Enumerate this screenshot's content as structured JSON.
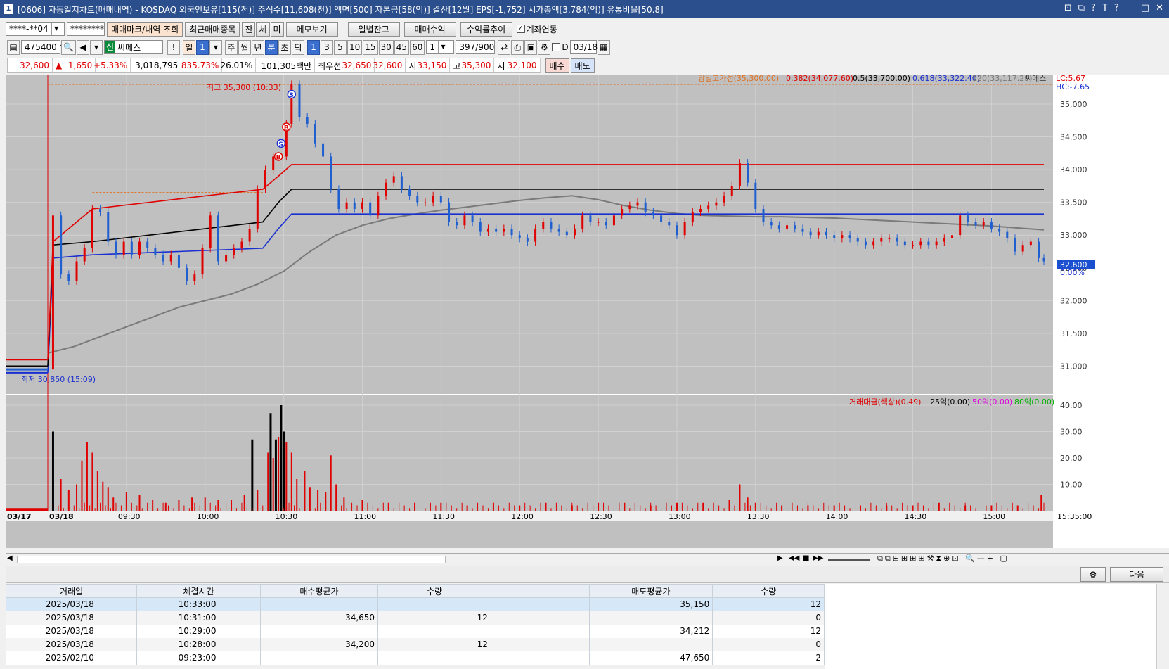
{
  "titlebar": {
    "window_number": "1",
    "title": "[0606] 자동일지차트(매매내역) - KOSDAQ 외국인보유[115(천)] 주식수[11,608(천)] 액면[500] 자본금[58(억)] 결산[12월] EPS[-1,752] 시가총액[3,784(억)] 유통비율[50.8]",
    "controls": [
      "⊡",
      "⧉",
      "?",
      "T",
      "?",
      "—",
      "□",
      "✕"
    ]
  },
  "toolbar1": {
    "account": "****-**04",
    "password": "********",
    "btn_mark": "매매마크/내역 조회",
    "btn_recent": "최근매매종목",
    "btn_jan": "잔",
    "btn_che": "체",
    "btn_mi": "미",
    "btn_memo": "메모보기",
    "btn_daily": "일별잔고",
    "btn_profit": "매매수익",
    "btn_trend": "수익률추이",
    "chk_link": "계좌연동"
  },
  "toolbar2": {
    "code": "475400",
    "shin": "신",
    "name": "씨메스",
    "excl": "!",
    "period_il": "일",
    "period_num": "1",
    "ju": "주",
    "wol": "월",
    "nyeon": "년",
    "bun": "분",
    "cho": "초",
    "tik": "틱",
    "intervals": [
      "1",
      "3",
      "5",
      "10",
      "15",
      "30",
      "45",
      "60"
    ],
    "interval_sel": "1",
    "count": "397",
    "count_max": "/900",
    "d_label": "D",
    "date": "03/18"
  },
  "quote": {
    "price": "32,600",
    "arrow": "▲",
    "change": "1,650",
    "rate": "+5.33%",
    "volume": "3,018,795",
    "vol_ratio": "835.73%",
    "turnover": "26.01%",
    "amount": "101,305백만",
    "best_ask_label": "최우선",
    "best_ask": "32,650",
    "best_bid": "32,600",
    "open_label": "시",
    "open": "33,150",
    "high_label": "고",
    "high": "35,300",
    "low_label": "저",
    "low": "32,100",
    "buy": "매수",
    "sell": "매도"
  },
  "colors": {
    "bg": "#c0c0c0",
    "up": "#e00000",
    "down": "#1f5fd0",
    "ma": "#7a7a7a",
    "high_line": "#e00000",
    "mid_line": "#000000",
    "low_line": "#1a2fd0",
    "fib_orange": "#e07020"
  },
  "chart_data": {
    "type": "line",
    "legend_top": {
      "high_label": "당일고가선(35,300.00)",
      "f382": "0.382(34,077.60)",
      "f5": "0.5(33,700.00)",
      "f618": "0.618(33,322.40)",
      "ma120": "120(33,117.29)",
      "stock": "씨메스"
    },
    "corner_lc": "LC:5.67",
    "corner_hc": "HC:-7.65",
    "high_marker": "최고 35,300 (10:33)",
    "low_marker": "최저 30,850 (15:09)",
    "current_price_tag": "32,600",
    "current_pct": "0.00%",
    "y_ticks": [
      "35,000",
      "34,500",
      "34,000",
      "33,500",
      "33,000",
      "32,500",
      "32,000",
      "31,500",
      "31,000"
    ],
    "y_values": [
      35000,
      34500,
      34000,
      33500,
      33000,
      32500,
      32000,
      31500,
      31000
    ],
    "ylim": [
      30780,
      35300
    ],
    "x_labels": [
      "03/17",
      "03/18",
      "09:30",
      "10:00",
      "10:30",
      "11:00",
      "11:30",
      "12:00",
      "12:30",
      "13:00",
      "13:30",
      "14:00",
      "14:30",
      "15:00",
      "15:35:00"
    ],
    "x_times": [
      "09:00",
      "09:00",
      "09:30",
      "10:00",
      "10:30",
      "11:00",
      "11:30",
      "12:00",
      "12:30",
      "13:00",
      "13:30",
      "14:00",
      "14:30",
      "15:00",
      "15:35"
    ],
    "price_series": [
      [
        "09:00",
        30950
      ],
      [
        "09:02",
        33300
      ],
      [
        "09:05",
        32400
      ],
      [
        "09:08",
        32300
      ],
      [
        "09:11",
        32600
      ],
      [
        "09:14",
        32800
      ],
      [
        "09:17",
        33400
      ],
      [
        "09:20",
        33350
      ],
      [
        "09:23",
        32900
      ],
      [
        "09:26",
        32700
      ],
      [
        "09:29",
        32900
      ],
      [
        "09:32",
        32700
      ],
      [
        "09:35",
        32900
      ],
      [
        "09:38",
        32800
      ],
      [
        "09:41",
        32700
      ],
      [
        "09:44",
        32600
      ],
      [
        "09:47",
        32700
      ],
      [
        "09:50",
        32500
      ],
      [
        "09:53",
        32300
      ],
      [
        "09:56",
        32400
      ],
      [
        "09:59",
        32800
      ],
      [
        "10:02",
        33300
      ],
      [
        "10:05",
        32600
      ],
      [
        "10:08",
        32700
      ],
      [
        "10:11",
        32800
      ],
      [
        "10:14",
        32900
      ],
      [
        "10:17",
        33100
      ],
      [
        "10:20",
        33700
      ],
      [
        "10:23",
        34000
      ],
      [
        "10:26",
        34200
      ],
      [
        "10:28",
        34200
      ],
      [
        "10:31",
        34700
      ],
      [
        "10:33",
        35300
      ],
      [
        "10:36",
        34800
      ],
      [
        "10:39",
        34700
      ],
      [
        "10:42",
        34400
      ],
      [
        "10:45",
        34200
      ],
      [
        "10:48",
        33700
      ],
      [
        "10:51",
        33400
      ],
      [
        "10:54",
        33500
      ],
      [
        "10:57",
        33400
      ],
      [
        "11:00",
        33500
      ],
      [
        "11:03",
        33300
      ],
      [
        "11:06",
        33600
      ],
      [
        "11:09",
        33800
      ],
      [
        "11:12",
        33900
      ],
      [
        "11:15",
        33700
      ],
      [
        "11:18",
        33600
      ],
      [
        "11:21",
        33500
      ],
      [
        "11:24",
        33500
      ],
      [
        "11:27",
        33600
      ],
      [
        "11:30",
        33500
      ],
      [
        "11:33",
        33200
      ],
      [
        "11:36",
        33150
      ],
      [
        "11:39",
        33300
      ],
      [
        "11:42",
        33200
      ],
      [
        "11:45",
        33050
      ],
      [
        "11:48",
        33100
      ],
      [
        "11:51",
        33050
      ],
      [
        "11:54",
        33100
      ],
      [
        "11:57",
        33000
      ],
      [
        "12:00",
        32950
      ],
      [
        "12:03",
        32900
      ],
      [
        "12:06",
        33100
      ],
      [
        "12:09",
        33200
      ],
      [
        "12:12",
        33100
      ],
      [
        "12:15",
        33050
      ],
      [
        "12:18",
        33000
      ],
      [
        "12:21",
        33100
      ],
      [
        "12:24",
        33300
      ],
      [
        "12:27",
        33200
      ],
      [
        "12:30",
        33200
      ],
      [
        "12:33",
        33150
      ],
      [
        "12:36",
        33300
      ],
      [
        "12:39",
        33400
      ],
      [
        "12:42",
        33450
      ],
      [
        "12:45",
        33500
      ],
      [
        "12:48",
        33350
      ],
      [
        "12:51",
        33300
      ],
      [
        "12:54",
        33200
      ],
      [
        "12:57",
        33150
      ],
      [
        "13:00",
        33000
      ],
      [
        "13:03",
        33200
      ],
      [
        "13:06",
        33350
      ],
      [
        "13:09",
        33400
      ],
      [
        "13:12",
        33450
      ],
      [
        "13:15",
        33500
      ],
      [
        "13:18",
        33600
      ],
      [
        "13:21",
        33750
      ],
      [
        "13:24",
        34100
      ],
      [
        "13:27",
        33800
      ],
      [
        "13:30",
        33400
      ],
      [
        "13:33",
        33200
      ],
      [
        "13:36",
        33150
      ],
      [
        "13:39",
        33100
      ],
      [
        "13:42",
        33150
      ],
      [
        "13:45",
        33100
      ],
      [
        "13:48",
        33050
      ],
      [
        "13:51",
        33000
      ],
      [
        "13:54",
        33050
      ],
      [
        "13:57",
        33000
      ],
      [
        "14:00",
        32950
      ],
      [
        "14:03",
        33000
      ],
      [
        "14:06",
        32950
      ],
      [
        "14:09",
        32900
      ],
      [
        "14:12",
        32850
      ],
      [
        "14:15",
        32900
      ],
      [
        "14:18",
        32950
      ],
      [
        "14:21",
        32950
      ],
      [
        "14:24",
        32900
      ],
      [
        "14:27",
        32850
      ],
      [
        "14:30",
        32850
      ],
      [
        "14:33",
        32900
      ],
      [
        "14:36",
        32850
      ],
      [
        "14:39",
        32900
      ],
      [
        "14:42",
        32950
      ],
      [
        "14:45",
        33000
      ],
      [
        "14:48",
        33300
      ],
      [
        "14:51",
        33200
      ],
      [
        "14:54",
        33150
      ],
      [
        "14:57",
        33200
      ],
      [
        "15:00",
        33100
      ],
      [
        "15:03",
        33050
      ],
      [
        "15:06",
        32950
      ],
      [
        "15:09",
        32750
      ],
      [
        "15:12",
        32850
      ],
      [
        "15:15",
        32900
      ],
      [
        "15:18",
        32650
      ],
      [
        "15:20",
        32600
      ]
    ],
    "ma_series": [
      [
        "09:00",
        31200
      ],
      [
        "09:10",
        31300
      ],
      [
        "09:20",
        31450
      ],
      [
        "09:30",
        31600
      ],
      [
        "09:40",
        31750
      ],
      [
        "09:50",
        31900
      ],
      [
        "10:00",
        32000
      ],
      [
        "10:10",
        32100
      ],
      [
        "10:20",
        32250
      ],
      [
        "10:30",
        32450
      ],
      [
        "10:40",
        32750
      ],
      [
        "10:50",
        33000
      ],
      [
        "11:00",
        33150
      ],
      [
        "11:10",
        33250
      ],
      [
        "11:20",
        33320
      ],
      [
        "11:30",
        33380
      ],
      [
        "11:40",
        33430
      ],
      [
        "11:50",
        33480
      ],
      [
        "12:00",
        33530
      ],
      [
        "12:10",
        33570
      ],
      [
        "12:20",
        33600
      ],
      [
        "12:30",
        33540
      ],
      [
        "12:40",
        33450
      ],
      [
        "12:50",
        33380
      ],
      [
        "13:00",
        33330
      ],
      [
        "13:10",
        33300
      ],
      [
        "13:20",
        33290
      ],
      [
        "13:30",
        33280
      ],
      [
        "13:40",
        33280
      ],
      [
        "13:50",
        33270
      ],
      [
        "14:00",
        33260
      ],
      [
        "14:10",
        33240
      ],
      [
        "14:20",
        33220
      ],
      [
        "14:30",
        33200
      ],
      [
        "14:40",
        33180
      ],
      [
        "14:50",
        33160
      ],
      [
        "15:00",
        33140
      ],
      [
        "15:10",
        33110
      ],
      [
        "15:20",
        33080
      ]
    ],
    "day_high_series": [
      [
        "09:00",
        31100
      ],
      [
        "09:02",
        32900
      ],
      [
        "09:17",
        33400
      ],
      [
        "10:22",
        33700
      ],
      [
        "10:28",
        33900
      ],
      [
        "10:33",
        34077
      ]
    ],
    "day_mid_series": [
      [
        "09:00",
        31000
      ],
      [
        "09:02",
        32850
      ],
      [
        "09:17",
        32900
      ],
      [
        "10:22",
        33200
      ],
      [
        "10:28",
        33500
      ],
      [
        "10:33",
        33700
      ]
    ],
    "day_low_series": [
      [
        "09:00",
        30900
      ],
      [
        "09:02",
        32650
      ],
      [
        "09:17",
        32700
      ],
      [
        "10:22",
        32800
      ],
      [
        "10:28",
        33100
      ],
      [
        "10:33",
        33322
      ]
    ],
    "trade_marks": [
      {
        "time": "10:28",
        "price": 34200,
        "label": "B"
      },
      {
        "time": "10:29",
        "price": 34400,
        "label": "S"
      },
      {
        "time": "10:31",
        "price": 34650,
        "label": "B"
      },
      {
        "time": "10:33",
        "price": 35150,
        "label": "S"
      }
    ],
    "volume_panel": {
      "legend_main": "거래대금(색상)(0.49)",
      "legend_25": "25억(0.00)",
      "legend_50": "50억(0.00)",
      "legend_80": "80억(0.00)",
      "y_ticks": [
        "40.00",
        "30.00",
        "20.00",
        "10.00"
      ],
      "y_values": [
        40,
        30,
        20,
        10
      ],
      "ylim": [
        0,
        40
      ],
      "black_bars": [
        [
          "09:02",
          30
        ],
        [
          "10:18",
          27
        ],
        [
          "10:25",
          37
        ],
        [
          "10:27",
          27
        ],
        [
          "10:29",
          40
        ],
        [
          "10:30",
          30
        ]
      ],
      "red_bars": [
        [
          "09:05",
          12
        ],
        [
          "09:08",
          8
        ],
        [
          "09:11",
          10
        ],
        [
          "09:13",
          19
        ],
        [
          "09:15",
          26
        ],
        [
          "09:17",
          22
        ],
        [
          "09:19",
          15
        ],
        [
          "09:21",
          11
        ],
        [
          "09:23",
          9
        ],
        [
          "09:25",
          5
        ],
        [
          "09:30",
          7
        ],
        [
          "09:35",
          6
        ],
        [
          "09:40",
          4
        ],
        [
          "09:45",
          3
        ],
        [
          "09:50",
          4
        ],
        [
          "09:55",
          5
        ],
        [
          "10:00",
          5
        ],
        [
          "10:05",
          4
        ],
        [
          "10:10",
          4
        ],
        [
          "10:15",
          6
        ],
        [
          "10:20",
          8
        ],
        [
          "10:24",
          22
        ],
        [
          "10:26",
          20
        ],
        [
          "10:28",
          28
        ],
        [
          "10:31",
          26
        ],
        [
          "10:33",
          22
        ],
        [
          "10:35",
          12
        ],
        [
          "10:38",
          15
        ],
        [
          "10:40",
          9
        ],
        [
          "10:43",
          8
        ],
        [
          "10:46",
          7
        ],
        [
          "10:48",
          21
        ],
        [
          "10:50",
          10
        ],
        [
          "10:53",
          5
        ],
        [
          "11:00",
          4
        ],
        [
          "11:10",
          3
        ],
        [
          "11:20",
          3
        ],
        [
          "11:30",
          3
        ],
        [
          "11:40",
          2
        ],
        [
          "11:50",
          3
        ],
        [
          "12:00",
          2
        ],
        [
          "12:10",
          3
        ],
        [
          "12:20",
          2
        ],
        [
          "12:30",
          3
        ],
        [
          "12:40",
          3
        ],
        [
          "12:50",
          2
        ],
        [
          "13:00",
          3
        ],
        [
          "13:10",
          3
        ],
        [
          "13:20",
          4
        ],
        [
          "13:24",
          10
        ],
        [
          "13:27",
          5
        ],
        [
          "13:30",
          3
        ],
        [
          "13:40",
          2
        ],
        [
          "13:50",
          2
        ],
        [
          "14:00",
          2
        ],
        [
          "14:10",
          2
        ],
        [
          "14:20",
          2
        ],
        [
          "14:30",
          2
        ],
        [
          "14:40",
          3
        ],
        [
          "14:50",
          2
        ],
        [
          "15:00",
          2
        ],
        [
          "15:10",
          2
        ],
        [
          "15:19",
          6
        ]
      ]
    }
  },
  "scrollbar": {
    "page_next": "다음",
    "settings": "⚙"
  },
  "table": {
    "headers": [
      "거래일",
      "체결시간",
      "매수평균가",
      "수량",
      "",
      "매도평균가",
      "수량"
    ],
    "rows": [
      [
        "2025/03/18",
        "10:33:00",
        "",
        "",
        "",
        "35,150",
        "12"
      ],
      [
        "2025/03/18",
        "10:31:00",
        "34,650",
        "12",
        "",
        "",
        "0"
      ],
      [
        "2025/03/18",
        "10:29:00",
        "",
        "",
        "",
        "34,212",
        "12"
      ],
      [
        "2025/03/18",
        "10:28:00",
        "34,200",
        "12",
        "",
        "",
        "0"
      ],
      [
        "2025/02/10",
        "09:23:00",
        "",
        "",
        "",
        "47,650",
        "2"
      ]
    ]
  }
}
